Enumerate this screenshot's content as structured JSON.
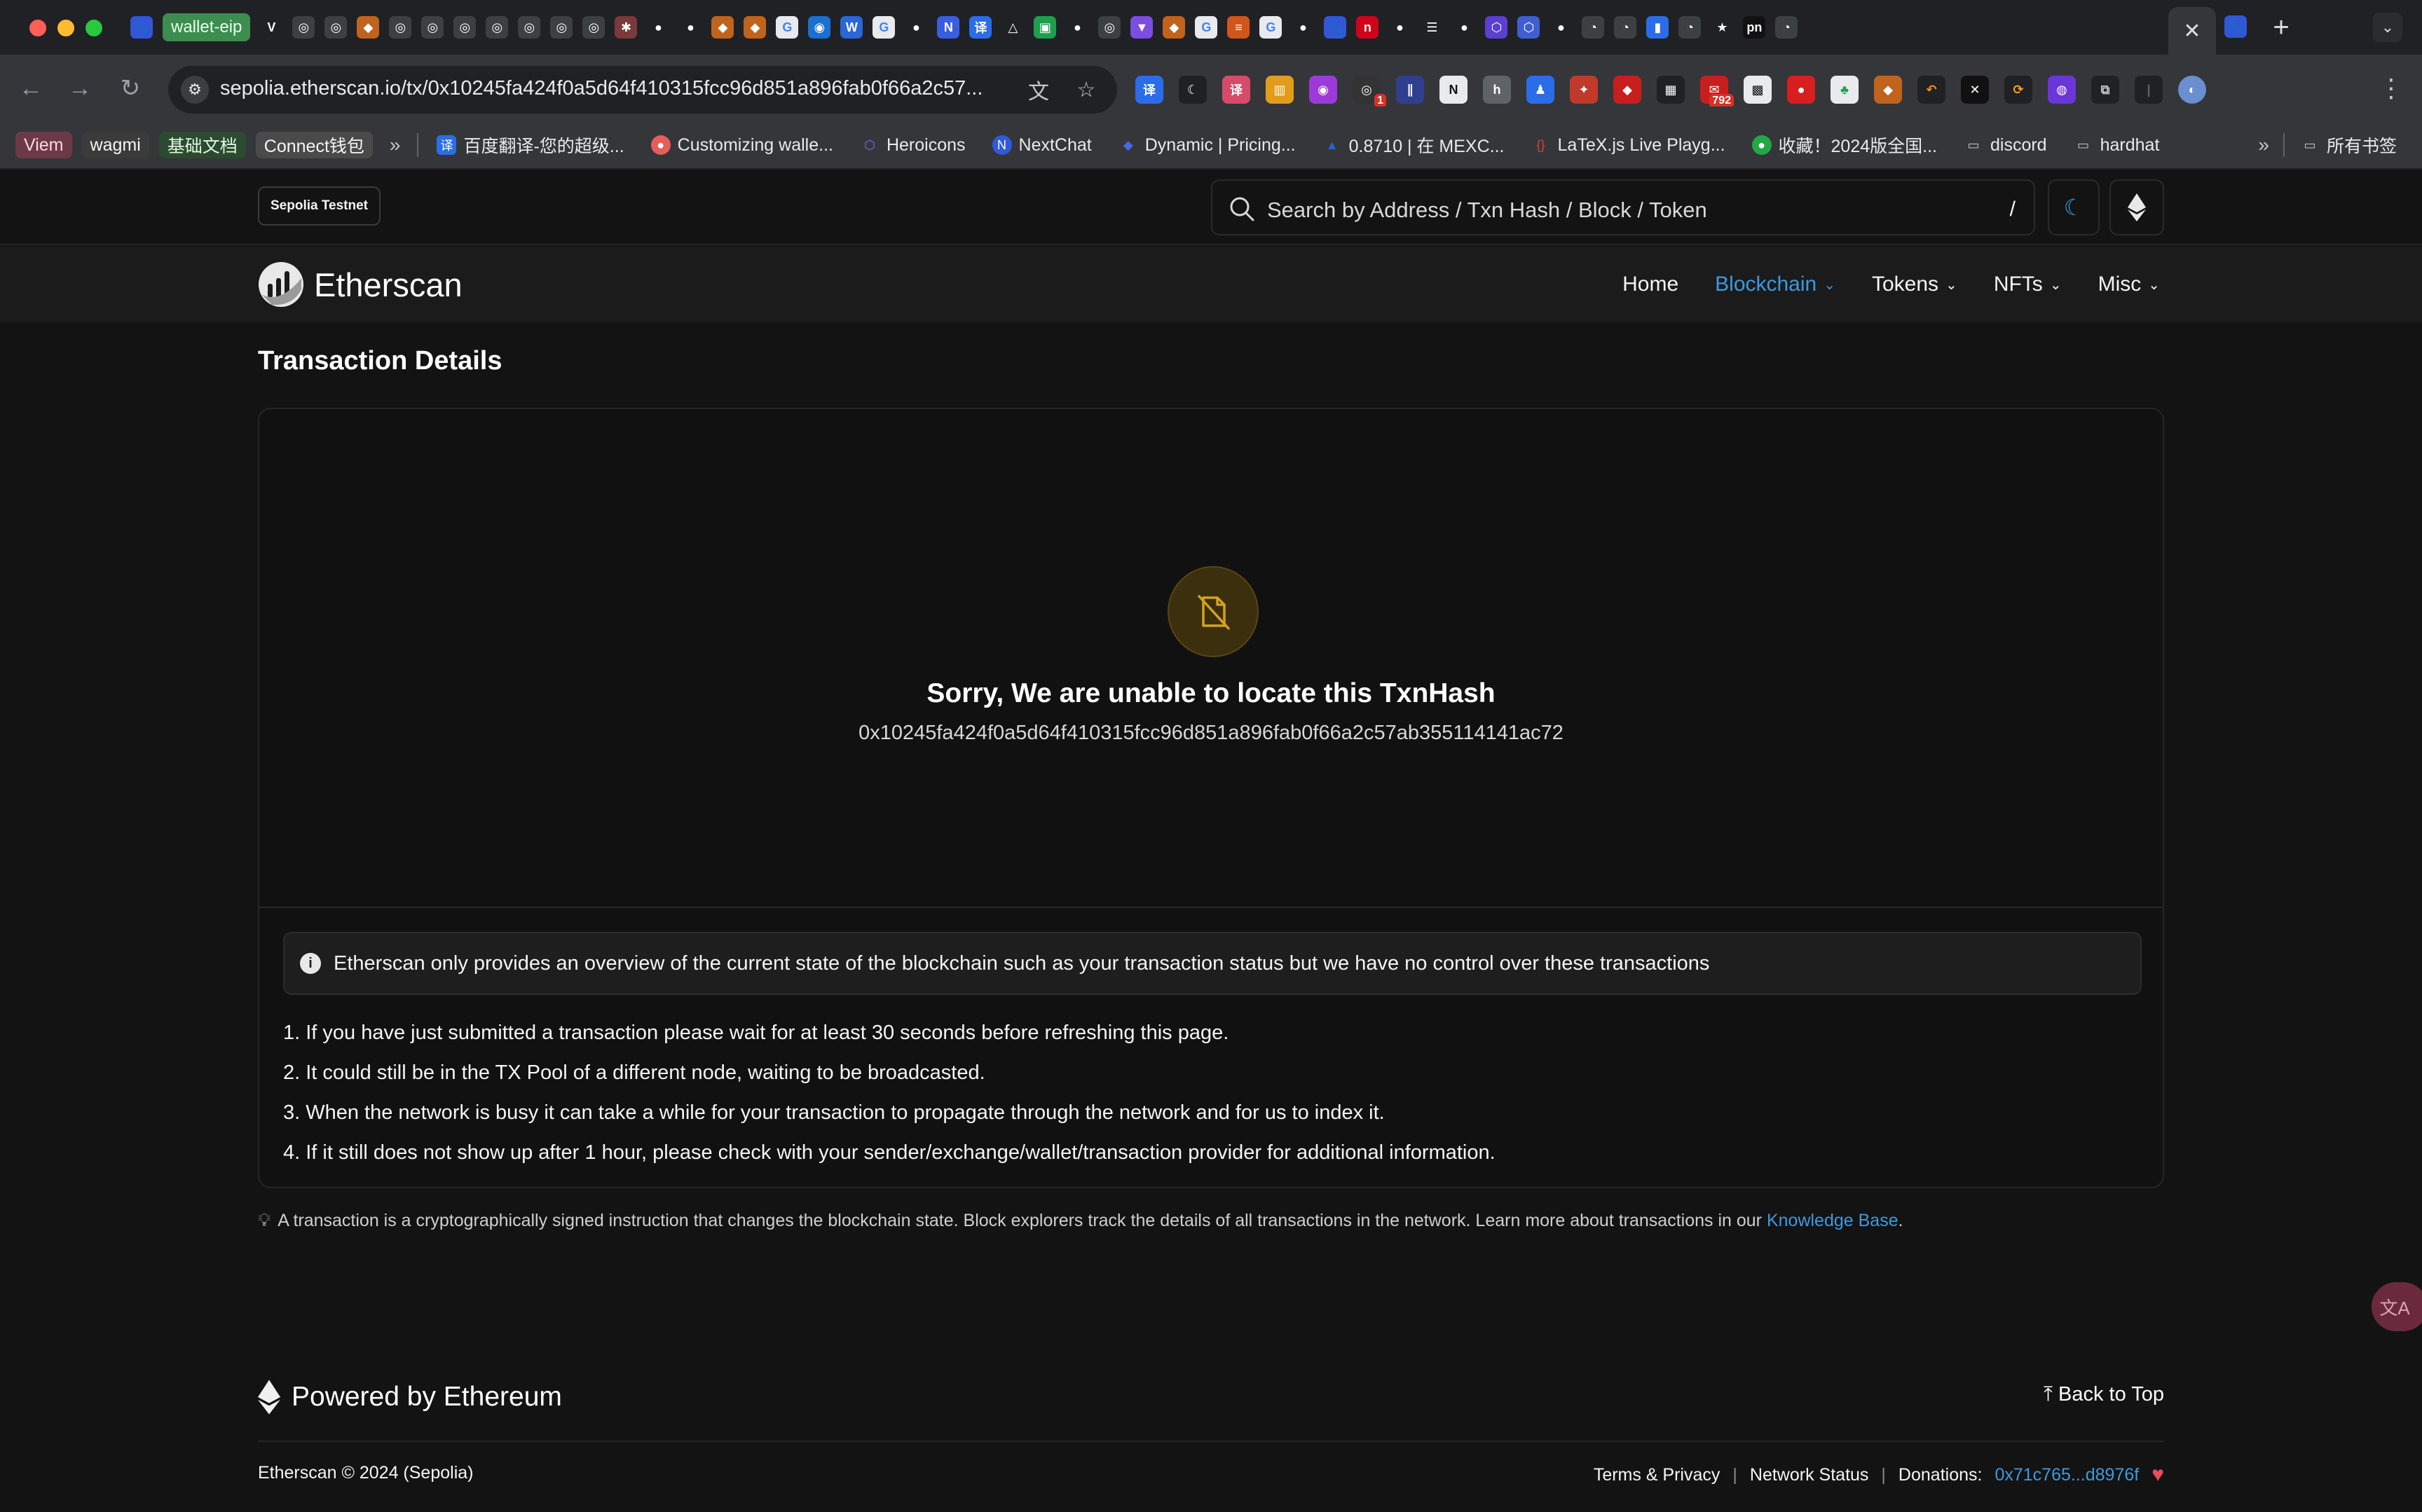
{
  "browser": {
    "tabs": {
      "first_pinned_label": "wallet-eip",
      "letter_tab": "V",
      "active_close": "✕",
      "new_tab": "+",
      "tab_menu": "⌄"
    },
    "address_bar": {
      "url": "sepolia.etherscan.io/tx/0x10245fa424f0a5d64f410315fcc96d851a896fab0f66a2c57...",
      "translate_icon": "文",
      "star_icon": "☆"
    },
    "extension_badge": "792",
    "extension_badge_small": "1",
    "bookmarks": {
      "chips": [
        {
          "label": "Viem",
          "bg": "#6b3a46",
          "fg": "#ffd6df"
        },
        {
          "label": "wagmi",
          "bg": "#3b3b3b",
          "fg": "#f5f5f5"
        },
        {
          "label": "基础文档",
          "bg": "#2c4a2f",
          "fg": "#dff5e1"
        },
        {
          "label": "Connect钱包",
          "bg": "#4a4a4a",
          "fg": "#f5f5f5"
        }
      ],
      "items": [
        {
          "label": "百度翻译-您的超级...",
          "color": "#2b6de8",
          "glyph": "译"
        },
        {
          "label": "Customizing walle...",
          "color": "#e85c5c",
          "glyph": "●"
        },
        {
          "label": "Heroicons",
          "color": "#7c6cf0",
          "glyph": "⬡"
        },
        {
          "label": "NextChat",
          "color": "#2f5bd8",
          "glyph": "N"
        },
        {
          "label": "Dynamic | Pricing...",
          "color": "#4a66e8",
          "glyph": "◆"
        },
        {
          "label": "0.8710 | 在 MEXC...",
          "color": "#2763d6",
          "glyph": "▲"
        },
        {
          "label": "LaTeX.js Live Playg...",
          "color": "#d8443a",
          "glyph": "{}"
        },
        {
          "label": "收藏！2024版全国...",
          "color": "#22a845",
          "glyph": "●"
        },
        {
          "label": "discord",
          "color": "#35363a",
          "glyph": "🗀"
        },
        {
          "label": "hardhat",
          "color": "#35363a",
          "glyph": "🗀"
        }
      ],
      "more": "»",
      "all_bookmarks": "所有书签"
    }
  },
  "site": {
    "network_badge": "Sepolia Testnet",
    "search_placeholder": "Search by Address / Txn Hash / Block / Token",
    "search_shortcut": "/",
    "logo_text": "Etherscan",
    "nav": [
      {
        "label": "Home",
        "dropdown": false,
        "active": false
      },
      {
        "label": "Blockchain",
        "dropdown": true,
        "active": true
      },
      {
        "label": "Tokens",
        "dropdown": true,
        "active": false
      },
      {
        "label": "NFTs",
        "dropdown": true,
        "active": false
      },
      {
        "label": "Misc",
        "dropdown": true,
        "active": false
      }
    ],
    "accent": "#3b9ae1"
  },
  "main": {
    "title": "Transaction Details",
    "not_found_title": "Sorry, We are unable to locate this TxnHash",
    "tx_hash": "0x10245fa424f0a5d64f410315fcc96d851a896fab0f66a2c57ab355114141ac72",
    "notice": "Etherscan only provides an overview of the current state of the blockchain such as your transaction status but we have no control over these transactions",
    "steps": [
      "1. If you have just submitted a transaction please wait for at least 30 seconds before refreshing this page.",
      "2. It could still be in the TX Pool of a different node, waiting to be broadcasted.",
      "3. When the network is busy it can take a while for your transaction to propagate through the network and for us to index it.",
      "4. If it still does not show up after 1 hour, please check with your sender/exchange/wallet/transaction provider for additional information."
    ],
    "hint_text": "A transaction is a cryptographically signed instruction that changes the blockchain state. Block explorers track the details of all transactions in the network. Learn more about transactions in our",
    "hint_link": "Knowledge Base",
    "hint_end": "."
  },
  "floating": {
    "label": "文A"
  },
  "footer": {
    "powered": "Powered by Ethereum",
    "back_to_top": "Back to Top",
    "copyright": "Etherscan © 2024 (Sepolia)",
    "terms": "Terms & Privacy",
    "network_status": "Network Status",
    "donations_label": "Donations:",
    "donations_address": "0x71c765...d8976f",
    "separator": "|"
  }
}
